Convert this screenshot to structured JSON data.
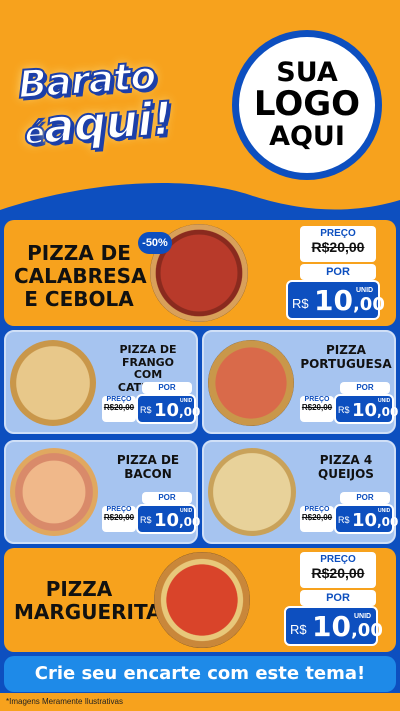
{
  "brand": {
    "line1": "Barato",
    "line2a": "é",
    "line2b": "aqui!"
  },
  "logo": {
    "line1": "SUA",
    "line2": "LOGO",
    "line3": "AQUI"
  },
  "discount_badge": "-50%",
  "labels": {
    "preco": "PREÇO",
    "por": "POR",
    "currency": "R$",
    "unit": "UNID"
  },
  "products": [
    {
      "name_l1": "PIZZA DE",
      "name_l2": "CALABRESA",
      "name_l3": "E CEBOLA",
      "old_price": "R$20,00",
      "new_int": "10",
      "new_dec": ",00"
    },
    {
      "name_l1": "PIZZA DE FRANGO",
      "name_l2": "COM CATUPIRY",
      "old_price": "R$20,00",
      "new_int": "10",
      "new_dec": ",00"
    },
    {
      "name_l1": "PIZZA",
      "name_l2": "PORTUGUESA",
      "old_price": "R$20,00",
      "new_int": "10",
      "new_dec": ",00"
    },
    {
      "name_l1": "PIZZA DE",
      "name_l2": "BACON",
      "old_price": "R$20,00",
      "new_int": "10",
      "new_dec": ",00"
    },
    {
      "name_l1": "PIZZA 4",
      "name_l2": "QUEIJOS",
      "old_price": "R$20,00",
      "new_int": "10",
      "new_dec": ",00"
    },
    {
      "name_l1": "PIZZA",
      "name_l2": "MARGUERITA",
      "old_price": "R$20,00",
      "new_int": "10",
      "new_dec": ",00"
    }
  ],
  "cta": "Crie seu encarte com este tema!",
  "footer_note": "*Imagens Meramente Ilustrativas",
  "colors": {
    "orange": "#f7a21d",
    "blue": "#0d4fbf",
    "light_blue": "#a6c4f0",
    "cta_blue": "#1e8ae8"
  }
}
